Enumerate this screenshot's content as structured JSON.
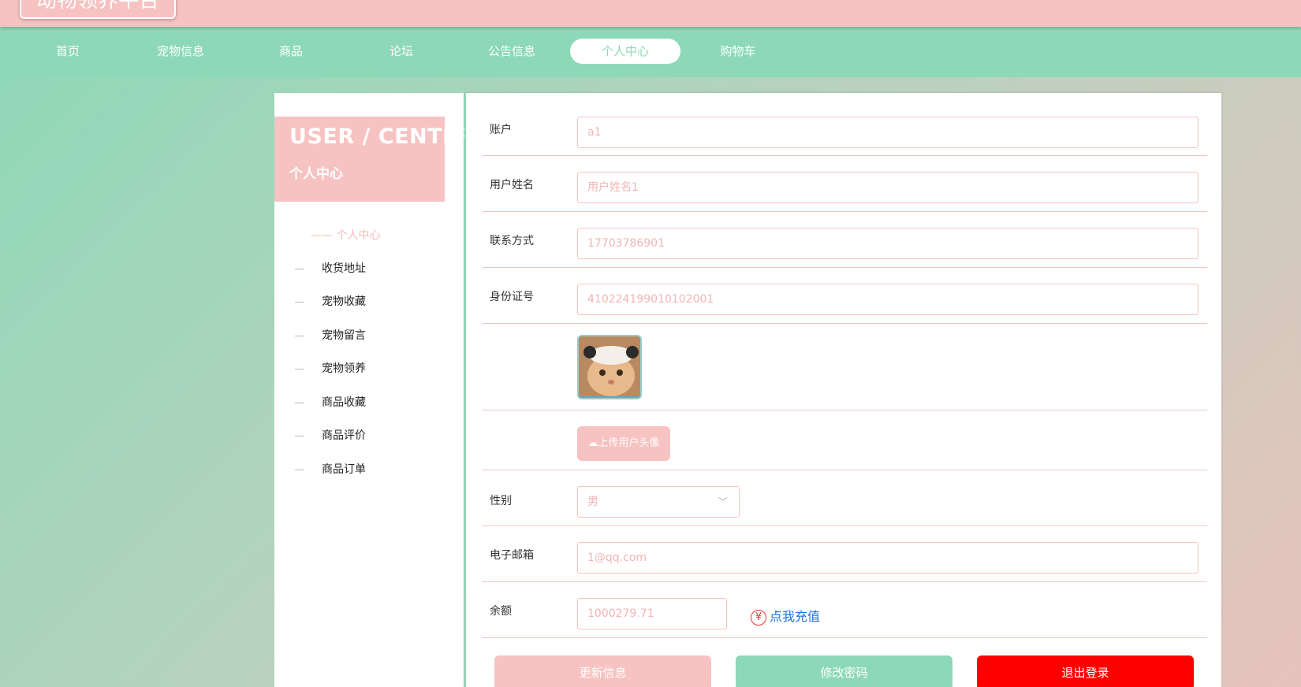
{
  "app": {
    "title": "动物领养平台"
  },
  "nav": {
    "items": [
      {
        "label": "首页"
      },
      {
        "label": "宠物信息"
      },
      {
        "label": "商品"
      },
      {
        "label": "论坛"
      },
      {
        "label": "公告信息"
      },
      {
        "label": "个人中心"
      },
      {
        "label": "购物车"
      }
    ],
    "active_index": 5
  },
  "sidebar": {
    "title": "USER / CENTER",
    "subtitle": "个人中心",
    "active_label": "—— 个人中心",
    "items": [
      {
        "label": "收货地址"
      },
      {
        "label": "宠物收藏"
      },
      {
        "label": "宠物留言"
      },
      {
        "label": "宠物领养"
      },
      {
        "label": "商品收藏"
      },
      {
        "label": "商品评价"
      },
      {
        "label": "商品订单"
      }
    ]
  },
  "form": {
    "account": {
      "label": "账户",
      "value": "a1"
    },
    "username": {
      "label": "用户姓名",
      "value": "用户姓名1"
    },
    "phone": {
      "label": "联系方式",
      "value": "17703786901"
    },
    "idcard": {
      "label": "身份证号",
      "value": "410224199010102001"
    },
    "upload_label": "上传用户头像",
    "gender": {
      "label": "性别",
      "value": "男"
    },
    "email": {
      "label": "电子邮箱",
      "value": "1@qq.com"
    },
    "balance": {
      "label": "余额",
      "value": "1000279.71",
      "recharge": "点我充值",
      "recharge_icon": "¥"
    }
  },
  "buttons": {
    "update": "更新信息",
    "change_password": "修改密码",
    "logout": "退出登录"
  },
  "colors": {
    "pink": "#f7c2c2",
    "mint": "#8dd9b7",
    "logout_red": "#ff0000",
    "link_blue": "#1a73e8"
  }
}
